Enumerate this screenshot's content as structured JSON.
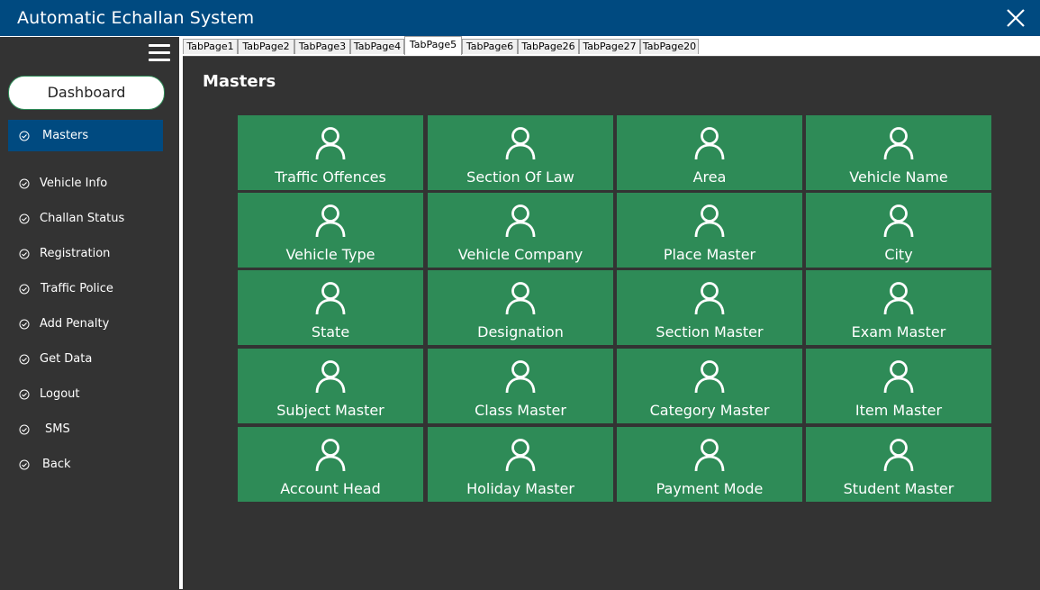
{
  "window": {
    "title": "Automatic Echallan System"
  },
  "sidebar": {
    "dashboard_label": "Dashboard",
    "items": [
      {
        "label": "Masters",
        "active": true
      },
      {
        "label": "Vehicle Info"
      },
      {
        "label": "Challan Status"
      },
      {
        "label": "Registration"
      },
      {
        "label": "Traffic Police"
      },
      {
        "label": "Add Penalty"
      },
      {
        "label": "Get Data"
      },
      {
        "label": "Logout"
      },
      {
        "label": "SMS"
      },
      {
        "label": "Back"
      }
    ]
  },
  "tabs": [
    {
      "label": "TabPage1"
    },
    {
      "label": "TabPage2"
    },
    {
      "label": "TabPage3"
    },
    {
      "label": "TabPage4"
    },
    {
      "label": "TabPage5",
      "active": true
    },
    {
      "label": "TabPage6"
    },
    {
      "label": "TabPage26"
    },
    {
      "label": "TabPage27"
    },
    {
      "label": "TabPage20"
    }
  ],
  "main": {
    "title": "Masters",
    "tile_icon": "user-icon",
    "tiles": [
      "Traffic Offences",
      "Section Of Law",
      "Area",
      "Vehicle Name",
      "Vehicle Type",
      "Vehicle Company",
      "Place Master",
      "City",
      "State",
      "Designation",
      "Section Master",
      "Exam Master",
      "Subject Master",
      "Class Master",
      "Category Master",
      "Item Master",
      "Account Head",
      "Holiday Master",
      "Payment Mode",
      "Student Master"
    ]
  },
  "colors": {
    "titlebar": "#004a80",
    "background": "#333333",
    "tile": "#2e8b57",
    "active_nav": "#004a80"
  }
}
